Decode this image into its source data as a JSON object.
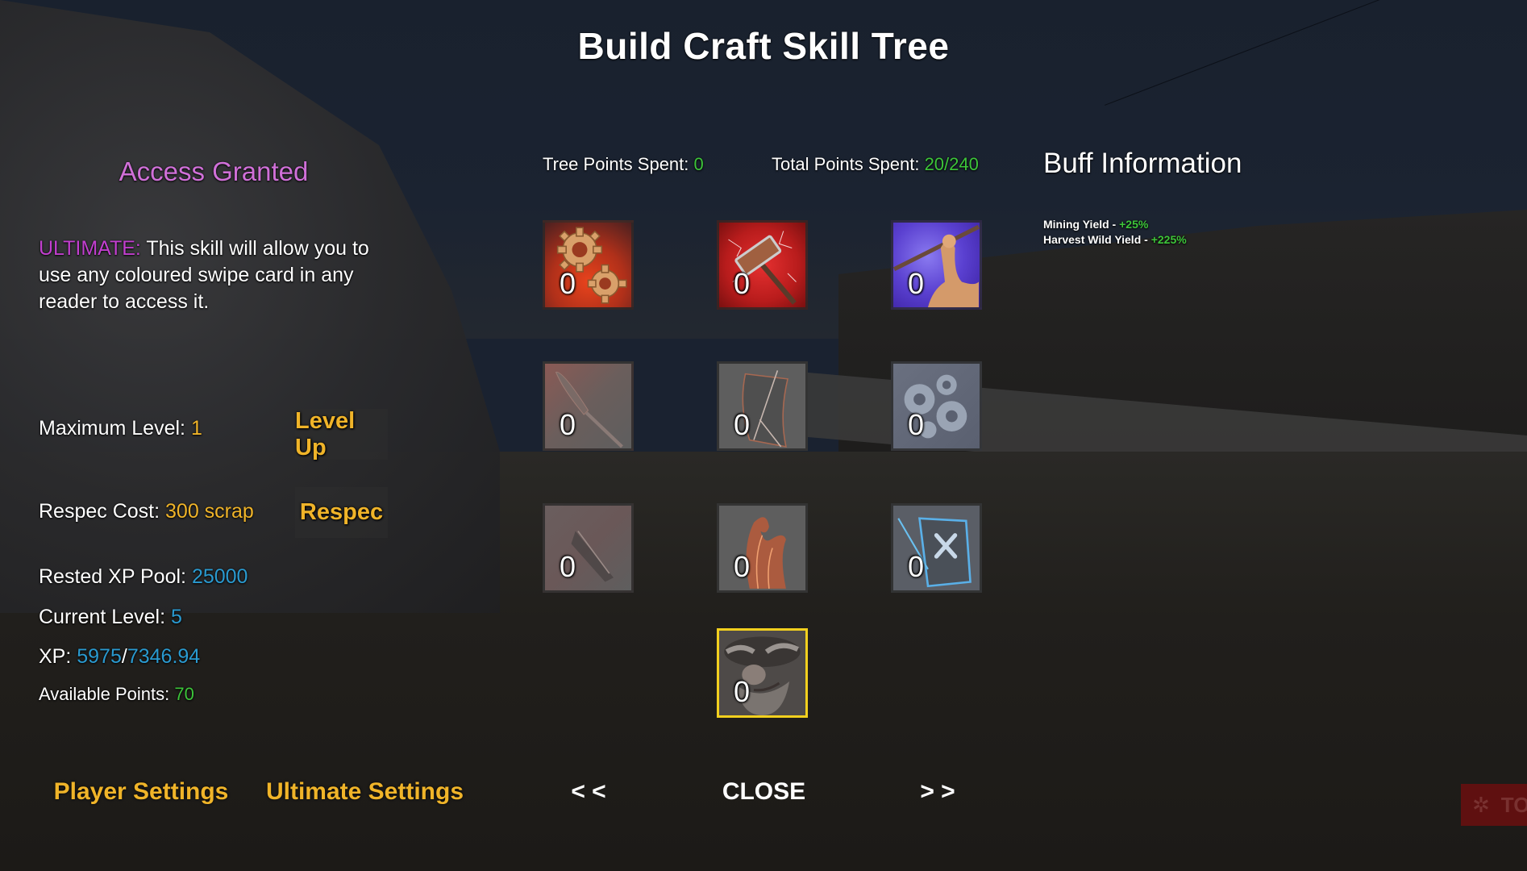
{
  "title": "Build Craft Skill Tree",
  "colors": {
    "accent_orange": "#f0b429",
    "value_green": "#3dc53a",
    "value_blue": "#2a9ad0",
    "ultimate_magenta": "#c23fcf",
    "access_pink": "#d070d8",
    "ultimate_border": "#f2d01e"
  },
  "skill_info": {
    "name": "Access Granted",
    "ultimate_label": "ULTIMATE:",
    "description": " This skill will allow you to use any coloured swipe card in any reader to access it."
  },
  "stats": {
    "max_level_label": "Maximum Level: ",
    "max_level_value": "1",
    "respec_cost_label": "Respec Cost: ",
    "respec_cost_value": "300 scrap",
    "rested_xp_label": "Rested XP Pool: ",
    "rested_xp_value": "25000",
    "current_level_label": "Current Level: ",
    "current_level_value": "5",
    "xp_label": "XP: ",
    "xp_current": "5975",
    "xp_separator": "/",
    "xp_required": "7346.94",
    "available_points_label": "Available Points: ",
    "available_points_value": "70"
  },
  "buttons": {
    "level_up": "Level Up",
    "respec": "Respec",
    "player_settings": "Player Settings",
    "ultimate_settings": "Ultimate Settings",
    "prev": "< <",
    "close": "CLOSE",
    "next": "> >"
  },
  "points": {
    "tree_label": "Tree Points Spent: ",
    "tree_value": "0",
    "total_label": "Total Points Spent: ",
    "total_value": "20/240"
  },
  "buff": {
    "title": "Buff Information",
    "lines": [
      {
        "label": "Mining Yield - ",
        "value": "+25%"
      },
      {
        "label": "Harvest Wild Yield - ",
        "value": "+225%"
      }
    ]
  },
  "skills": [
    {
      "icon": "gears-icon",
      "level": "0",
      "state": "active"
    },
    {
      "icon": "lightning-hammer-icon",
      "level": "0",
      "state": "active"
    },
    {
      "icon": "strong-arm-icon",
      "level": "0",
      "state": "active"
    },
    {
      "icon": "knife-icon",
      "level": "0",
      "state": "locked"
    },
    {
      "icon": "torn-shield-icon",
      "level": "0",
      "state": "locked"
    },
    {
      "icon": "cog-cluster-icon",
      "level": "0",
      "state": "locked"
    },
    {
      "icon": "blade-icon",
      "level": "0",
      "state": "locked"
    },
    {
      "icon": "flame-swirl-icon",
      "level": "0",
      "state": "locked"
    },
    {
      "icon": "wrench-shield-icon",
      "level": "0",
      "state": "locked"
    },
    {
      "icon": "dwarf-face-icon",
      "level": "0",
      "state": "ultimate-selected"
    }
  ],
  "corner_badge": {
    "text": "TO",
    "icon": "gear-icon"
  }
}
